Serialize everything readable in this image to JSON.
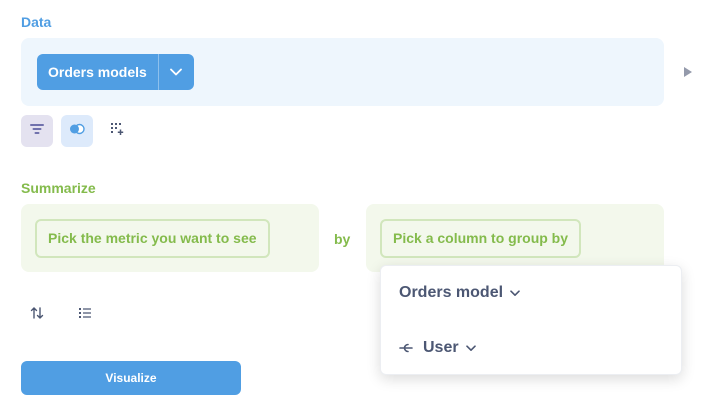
{
  "data_section": {
    "label": "Data",
    "source_label": "Orders models"
  },
  "summarize_section": {
    "label": "Summarize",
    "metric_placeholder": "Pick the metric you want to see",
    "by_label": "by",
    "group_placeholder": "Pick a column to group by"
  },
  "actions": {
    "visualize_label": "Visualize"
  },
  "popover": {
    "items": [
      {
        "label": "Orders model"
      },
      {
        "label": "User"
      }
    ]
  },
  "icons": {
    "source_caret": "chevron-down-icon",
    "run": "play-icon",
    "filter": "filter-icon",
    "join": "join-icon",
    "custom_column": "custom-column-icon",
    "sort": "sort-icon",
    "limit": "list-icon",
    "foreign_key": "foreign-key-icon"
  },
  "colors": {
    "brand": "#509ee3",
    "summarize": "#84bb4c",
    "data_panel_bg": "#eef6fd",
    "summarize_panel_bg": "#f3f8ec",
    "text": "#4c5773"
  }
}
